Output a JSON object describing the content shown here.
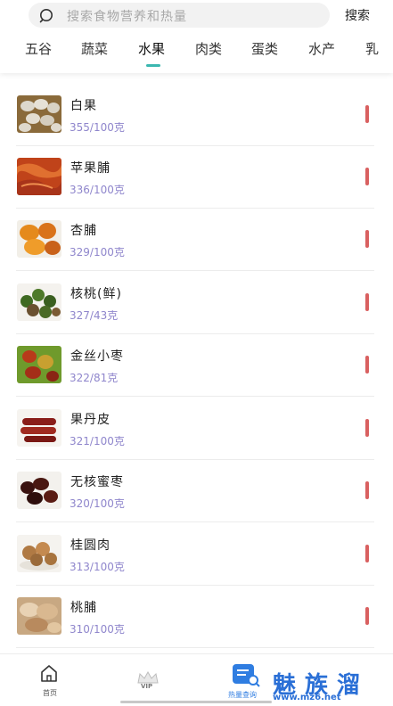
{
  "search": {
    "placeholder": "搜索食物营养和热量",
    "button_label": "搜索"
  },
  "tabs": [
    {
      "label": "五谷",
      "active": false
    },
    {
      "label": "蔬菜",
      "active": false
    },
    {
      "label": "水果",
      "active": true
    },
    {
      "label": "肉类",
      "active": false
    },
    {
      "label": "蛋类",
      "active": false
    },
    {
      "label": "水产",
      "active": false
    },
    {
      "label": "乳",
      "active": false
    }
  ],
  "accent_color": "#3bb7b0",
  "calorie_color": "#8f86cc",
  "bar_color": "#d96060",
  "foods": [
    {
      "name": "白果",
      "kcal": "355/100克",
      "image": "ginkgo-nuts-image"
    },
    {
      "name": "苹果脯",
      "kcal": "336/100克",
      "image": "dried-apple-image"
    },
    {
      "name": "杏脯",
      "kcal": "329/100克",
      "image": "dried-apricot-image"
    },
    {
      "name": "核桃(鲜)",
      "kcal": "327/43克",
      "image": "fresh-walnut-image"
    },
    {
      "name": "金丝小枣",
      "kcal": "322/81克",
      "image": "jujube-image"
    },
    {
      "name": "果丹皮",
      "kcal": "321/100克",
      "image": "hawthorn-roll-image"
    },
    {
      "name": "无核蜜枣",
      "kcal": "320/100克",
      "image": "candied-date-image"
    },
    {
      "name": "桂圆肉",
      "kcal": "313/100克",
      "image": "longan-image"
    },
    {
      "name": "桃脯",
      "kcal": "310/100克",
      "image": "dried-peach-image"
    }
  ],
  "bottom_nav": {
    "home_label": "首页",
    "vip_label": "VIP",
    "calorie_label": "热量查询",
    "home_icon": "home-icon",
    "vip_icon": "crown-icon",
    "calorie_icon": "calorie-search-icon"
  },
  "watermark": {
    "text": "魅族溜",
    "url": "www.mz6.net"
  }
}
